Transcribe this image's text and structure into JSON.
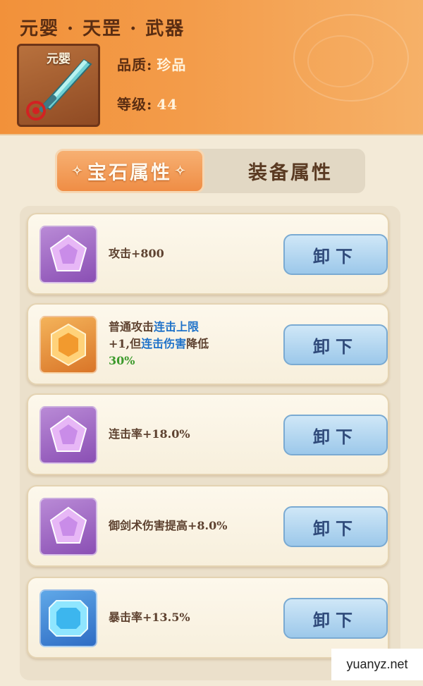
{
  "header": {
    "title": "元婴 · 天罡 · 武器",
    "icon_tier_label": "元婴",
    "quality_label": "品质:",
    "quality_value": "珍品",
    "level_label": "等级:",
    "level_value": "44",
    "accent_color": "#f2913a"
  },
  "tabs": [
    {
      "label": "宝石属性",
      "active": true
    },
    {
      "label": "装备属性",
      "active": false
    }
  ],
  "gems": [
    {
      "gem": "purple-pentagon-gem",
      "text": "攻击+800",
      "button": "卸下"
    },
    {
      "gem": "orange-hexagon-gem",
      "parts": [
        "普通攻击",
        "连击上限",
        "+1,但",
        "连击伤害",
        "降低",
        "30%"
      ],
      "button": "卸下"
    },
    {
      "gem": "purple-pentagon-gem",
      "text": "连击率+18.0%",
      "button": "卸下"
    },
    {
      "gem": "purple-pentagon-gem",
      "text": "御剑术伤害提高+8.0%",
      "button": "卸下"
    },
    {
      "gem": "blue-square-gem",
      "text": "暴击率+13.5%",
      "button": "卸下"
    }
  ],
  "watermark": "yuanyz.net"
}
